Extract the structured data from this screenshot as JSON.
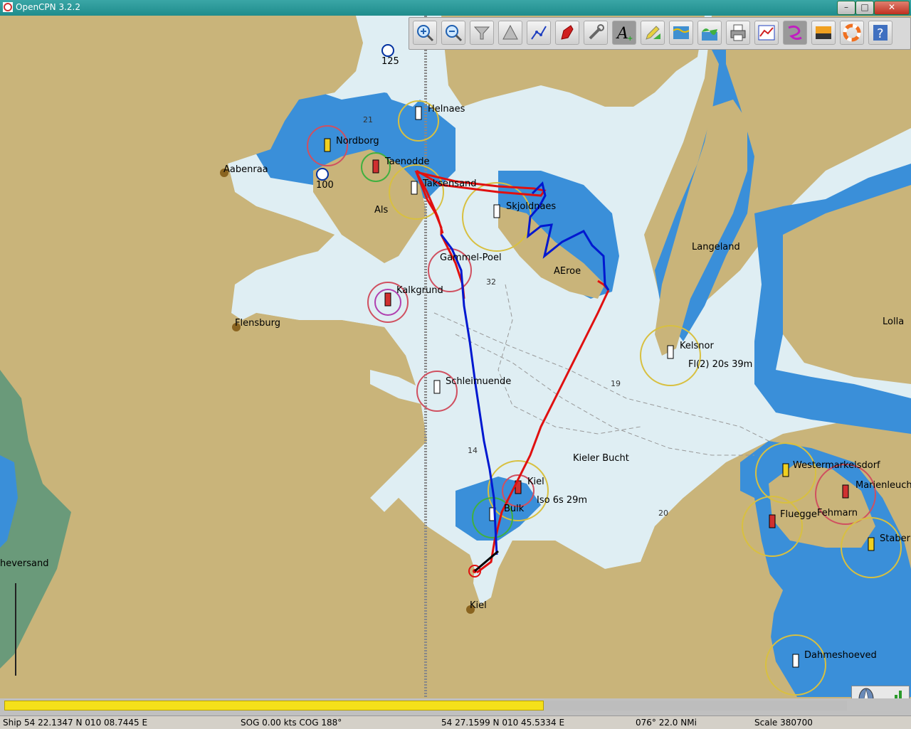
{
  "window": {
    "title": "OpenCPN 3.2.2",
    "min": "–",
    "max": "□",
    "close": "✕"
  },
  "colors": {
    "land": "#c9b47a",
    "deep_water": "#dfeef3",
    "shallow_water": "#3a8fd9",
    "route_red": "#e01010",
    "track_blue": "#0018d0",
    "title_bar": "#2a9a9a",
    "progress": "#f5e01a"
  },
  "toolbar": {
    "buttons": [
      {
        "name": "zoom-in",
        "icon": "magnifier-plus-icon"
      },
      {
        "name": "zoom-out",
        "icon": "magnifier-minus-icon"
      },
      {
        "name": "scale-in",
        "icon": "funnel-icon"
      },
      {
        "name": "scale-out",
        "icon": "cone-icon"
      },
      {
        "name": "create-route",
        "icon": "route-icon"
      },
      {
        "name": "auto-follow",
        "icon": "boat-icon"
      },
      {
        "name": "settings",
        "icon": "wrench-icon"
      },
      {
        "name": "text",
        "icon": "text-icon"
      },
      {
        "name": "current-tide",
        "icon": "pencil-icon"
      },
      {
        "name": "tides",
        "icon": "tide-icon"
      },
      {
        "name": "currents",
        "icon": "current-icon"
      },
      {
        "name": "print",
        "icon": "printer-icon"
      },
      {
        "name": "route-manager",
        "icon": "route-manager-icon"
      },
      {
        "name": "track",
        "icon": "track-icon"
      },
      {
        "name": "color-scheme",
        "icon": "sunset-icon"
      },
      {
        "name": "mob",
        "icon": "lifebuoy-icon"
      },
      {
        "name": "help",
        "icon": "help-icon"
      }
    ]
  },
  "map": {
    "places": [
      {
        "id": "helnaes",
        "text": "Helnaes"
      },
      {
        "id": "nordborg",
        "text": "Nordborg"
      },
      {
        "id": "aabenraa",
        "text": "Aabenraa"
      },
      {
        "id": "taenodde",
        "text": "Taenodde"
      },
      {
        "id": "taksensand",
        "text": "Taksensand"
      },
      {
        "id": "skjoldnaes",
        "text": "Skjoldnaes"
      },
      {
        "id": "als",
        "text": "Als"
      },
      {
        "id": "langeland",
        "text": "Langeland"
      },
      {
        "id": "gammel-poel",
        "text": "Gammel-Poel"
      },
      {
        "id": "aeroe",
        "text": "AEroe"
      },
      {
        "id": "kalkgrund",
        "text": "Kalkgrund"
      },
      {
        "id": "flensburg",
        "text": "Flensburg"
      },
      {
        "id": "kelsnor",
        "text": "Kelsnor"
      },
      {
        "id": "kelsnor-light",
        "text": "Fl(2) 20s 39m"
      },
      {
        "id": "lolland",
        "text": "Lolla"
      },
      {
        "id": "schleimuende",
        "text": "Schleimuende"
      },
      {
        "id": "kieler-bucht",
        "text": "Kieler Bucht"
      },
      {
        "id": "kiel-light",
        "text": "Kiel"
      },
      {
        "id": "kiel-light-char",
        "text": "Iso 6s 29m"
      },
      {
        "id": "friedrichsort",
        "text": "Bulk"
      },
      {
        "id": "westermarkelsdorf",
        "text": "Westermarkelsdorf"
      },
      {
        "id": "marienleuchte",
        "text": "Marienleuch"
      },
      {
        "id": "fluegge",
        "text": "Fluegge"
      },
      {
        "id": "fehmarn",
        "text": "Fehmarn"
      },
      {
        "id": "staberhuk",
        "text": "Staber"
      },
      {
        "id": "heversand",
        "text": "heversand"
      },
      {
        "id": "kiel",
        "text": "Kiel"
      },
      {
        "id": "dahmeshoeved",
        "text": "Dahmeshoeved"
      }
    ],
    "depths": [
      "21",
      "32",
      "19",
      "14",
      "20"
    ],
    "anchorages": [
      "125",
      "100"
    ]
  },
  "progress": {
    "fraction": 0.64
  },
  "status": {
    "ship": "Ship 54 22.1347 N   010 08.7445 E",
    "sog": "SOG 0.00 kts   COG 188°",
    "cursor": "54 27.1599 N   010 45.5334 E",
    "bearing": "076°   22.0 NMi",
    "scale": "Scale 380700"
  }
}
